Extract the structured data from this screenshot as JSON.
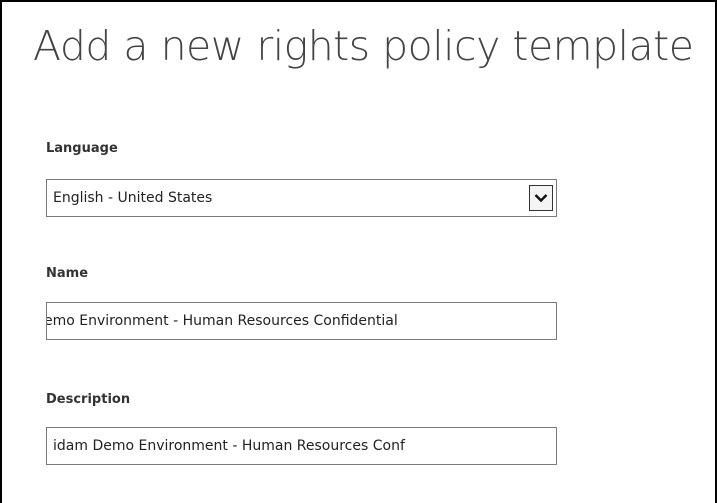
{
  "page": {
    "title": "Add a new rights policy template"
  },
  "form": {
    "language": {
      "label": "Language",
      "selected": "English - United States",
      "dropdown_icon": "chevron-down-icon"
    },
    "name": {
      "label": "Name",
      "value": "emo Environment - Human Resources Confidential"
    },
    "description": {
      "label": "Description",
      "value": "idam Demo Environment - Human Resources Conf"
    }
  }
}
